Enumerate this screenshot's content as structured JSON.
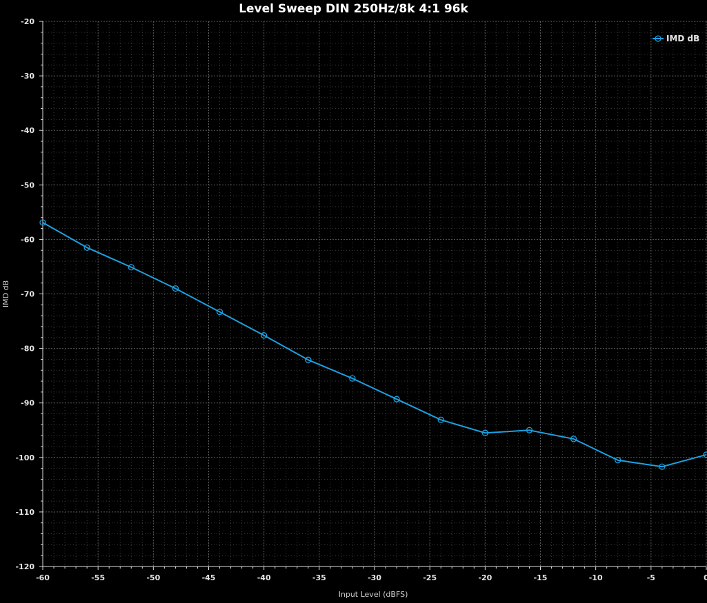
{
  "chart_data": {
    "type": "line",
    "title": "Level Sweep DIN 250Hz/8k 4:1 96k",
    "xlabel": "Input Level (dBFS)",
    "ylabel": "IMD dB",
    "xlim": [
      -60,
      0
    ],
    "ylim": [
      -120,
      -20
    ],
    "x_ticks": [
      "-60",
      "-55",
      "-50",
      "-45",
      "-40",
      "-35",
      "-30",
      "-25",
      "-20",
      "-15",
      "-10",
      "-5",
      "0"
    ],
    "y_ticks": [
      "-20",
      "-30",
      "-40",
      "-50",
      "-60",
      "-70",
      "-80",
      "-90",
      "-100",
      "-110",
      "-120"
    ],
    "grid": true,
    "legend_position": "top-right",
    "series": [
      {
        "name": "IMD dB",
        "color": "#1ba1e2",
        "marker": "circle",
        "x": [
          -60,
          -56,
          -52,
          -48,
          -44,
          -40,
          -36,
          -32,
          -28,
          -24,
          -20,
          -16,
          -12,
          -8,
          -4,
          0
        ],
        "y": [
          -56.9,
          -61.5,
          -65.1,
          -69.0,
          -73.3,
          -77.6,
          -82.1,
          -85.5,
          -89.3,
          -93.1,
          -95.5,
          -95.0,
          -96.6,
          -100.5,
          -101.7,
          -99.5
        ]
      }
    ]
  }
}
